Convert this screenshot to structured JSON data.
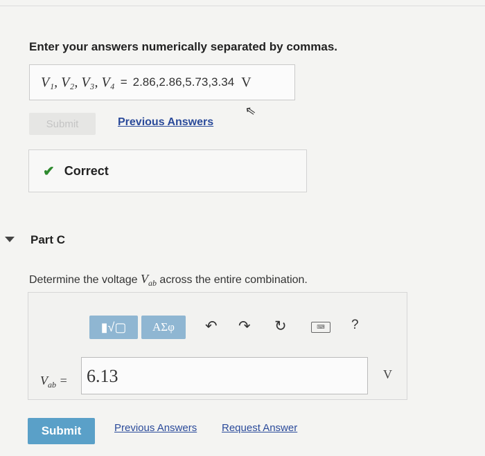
{
  "part_b": {
    "instruction": "Enter your answers numerically separated by commas.",
    "answer_vars": "V₁, V₂, V₃, V₄",
    "answer_eq": "=",
    "answer_value": "2.86,2.86,5.73,3.34",
    "answer_unit": "V",
    "submit_label": "Submit",
    "previous_answers_label": "Previous Answers",
    "feedback": "Correct"
  },
  "part_c": {
    "title": "Part C",
    "question_pre": "Determine the voltage ",
    "question_var": "V",
    "question_var_sub": "ab",
    "question_post": " across the entire combination.",
    "toolbar": {
      "templates_label": "▮√▢",
      "symbols_label": "ΑΣφ",
      "undo_icon": "↶",
      "redo_icon": "↷",
      "reset_icon": "↻",
      "keyboard_label": "⌨",
      "help_label": "?"
    },
    "input_var": "V",
    "input_var_sub": "ab",
    "input_eq": "=",
    "input_value": "6.13",
    "unit": "V",
    "submit_label": "Submit",
    "previous_answers_label": "Previous Answers",
    "request_answer_label": "Request Answer"
  },
  "colors": {
    "accent_button": "#5aa0c8",
    "toolbar_button": "#8fb6d2",
    "link": "#2a4a9a",
    "correct": "#2e8a2e"
  }
}
